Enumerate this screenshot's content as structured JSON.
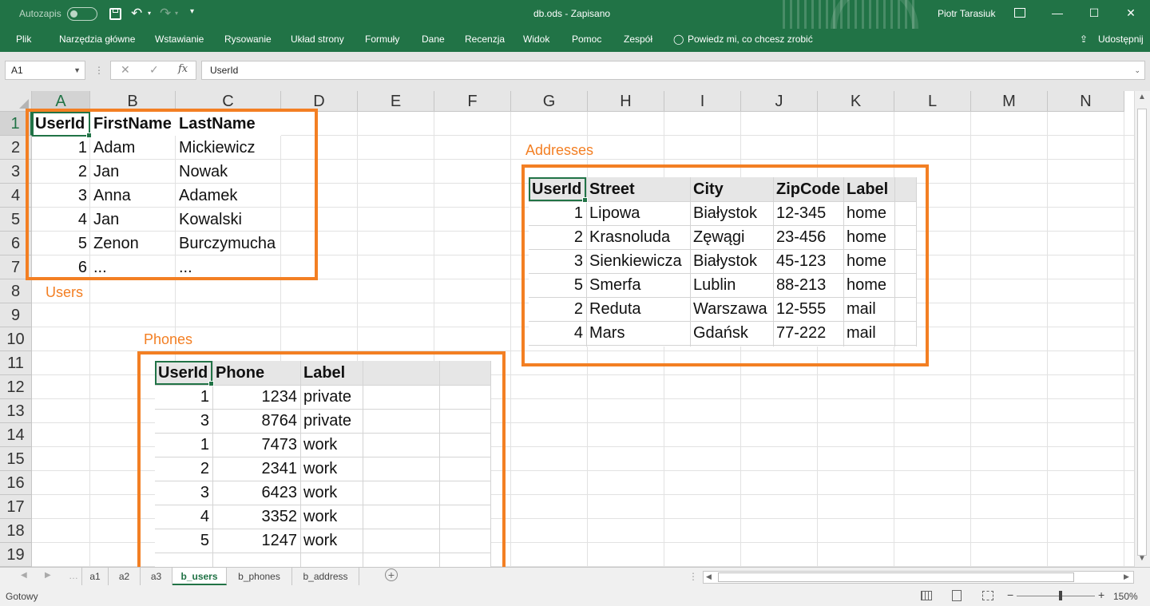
{
  "titlebar": {
    "autosave_label": "Autozapis",
    "doc_title": "db.ods  -  Zapisano",
    "user": "Piotr Tarasiuk",
    "minimize": "—",
    "restore": "☐",
    "close": "✕",
    "save_icon": "save-icon",
    "undo_icon": "undo-icon",
    "redo_icon": "redo-icon"
  },
  "ribbon": {
    "tabs": [
      "Plik",
      "Narzędzia główne",
      "Wstawianie",
      "Rysowanie",
      "Układ strony",
      "Formuły",
      "Dane",
      "Recenzja",
      "Widok",
      "Pomoc",
      "Zespół"
    ],
    "tellme": "Powiedz mi, co chcesz zrobić",
    "share": "Udostępnij"
  },
  "formula": {
    "namebox": "A1",
    "cancel": "✕",
    "enter": "✓",
    "fx": "fx",
    "content": "UserId"
  },
  "columns": [
    "A",
    "B",
    "C",
    "D",
    "E",
    "F",
    "G",
    "H",
    "I",
    "J",
    "K",
    "L",
    "M",
    "N"
  ],
  "rows": [
    "1",
    "2",
    "3",
    "4",
    "5",
    "6",
    "7",
    "8",
    "9",
    "10",
    "11",
    "12",
    "13",
    "14",
    "15",
    "16",
    "17",
    "18",
    "19"
  ],
  "users": {
    "headers": [
      "UserId",
      "FirstName",
      "LastName"
    ],
    "rows": [
      [
        "1",
        "Adam",
        "Mickiewicz"
      ],
      [
        "2",
        "Jan",
        "Nowak"
      ],
      [
        "3",
        "Anna",
        "Adamek"
      ],
      [
        "4",
        "Jan",
        "Kowalski"
      ],
      [
        "5",
        "Zenon",
        "Burczymucha"
      ],
      [
        "6",
        "...",
        "..."
      ]
    ],
    "label": "Users"
  },
  "addresses": {
    "label": "Addresses",
    "headers": [
      "UserId",
      "Street",
      "City",
      "ZipCode",
      "Label"
    ],
    "rows": [
      [
        "1",
        "Lipowa",
        "Białystok",
        "12-345",
        "home"
      ],
      [
        "2",
        "Krasnoluda",
        "Zęwągi",
        "23-456",
        "home"
      ],
      [
        "3",
        "Sienkiewicza",
        "Białystok",
        "45-123",
        "home"
      ],
      [
        "5",
        "Smerfa",
        "Lublin",
        "88-213",
        "home"
      ],
      [
        "2",
        "Reduta",
        "Warszawa",
        "12-555",
        "mail"
      ],
      [
        "4",
        "Mars",
        "Gdańsk",
        "77-222",
        "mail"
      ]
    ]
  },
  "phones": {
    "label": "Phones",
    "headers": [
      "UserId",
      "Phone",
      "Label"
    ],
    "rows": [
      [
        "1",
        "1234",
        "private"
      ],
      [
        "3",
        "8764",
        "private"
      ],
      [
        "1",
        "7473",
        "work"
      ],
      [
        "2",
        "2341",
        "work"
      ],
      [
        "3",
        "6423",
        "work"
      ],
      [
        "4",
        "3352",
        "work"
      ],
      [
        "5",
        "1247",
        "work"
      ]
    ]
  },
  "sheets": [
    "a1",
    "a2",
    "a3",
    "b_users",
    "b_phones",
    "b_address"
  ],
  "active_sheet": "b_users",
  "status": {
    "text": "Gotowy",
    "zoom": "150%",
    "minus": "−",
    "plus": "+"
  },
  "colors": {
    "excel_green": "#217346",
    "highlight_orange": "#f37f23"
  }
}
